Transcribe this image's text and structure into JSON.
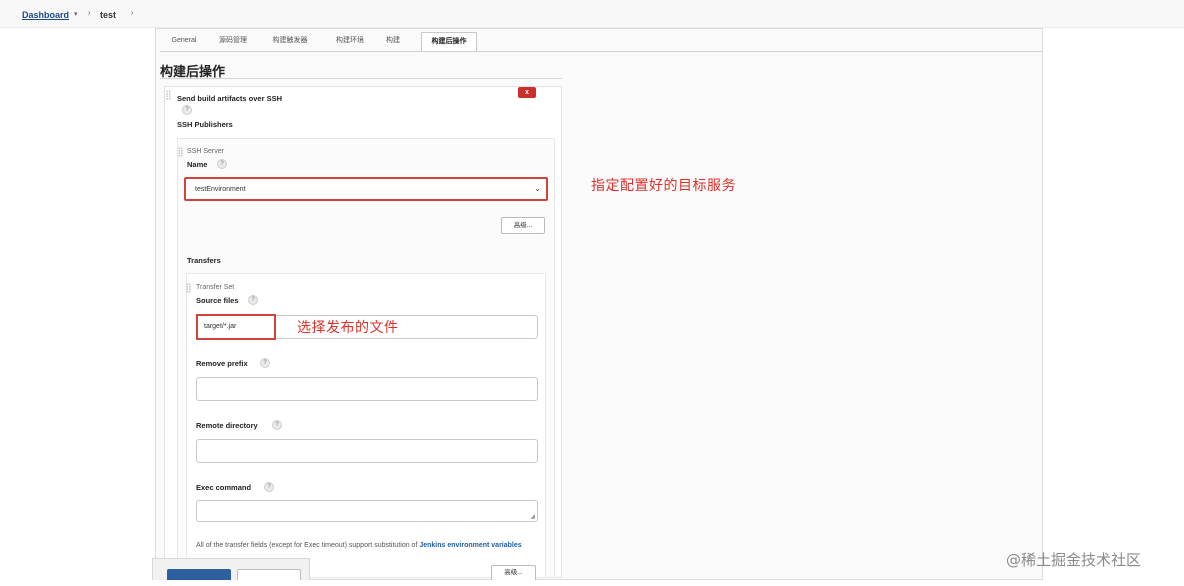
{
  "breadcrumb": {
    "root": "Dashboard",
    "project": "test"
  },
  "tabs": [
    "General",
    "源码管理",
    "构建触发器",
    "构建环境",
    "构建",
    "构建后操作"
  ],
  "section_title": "构建后操作",
  "step": {
    "title": "Send build artifacts over SSH",
    "help": "?",
    "delete_label": "x",
    "publishers_label": "SSH Publishers",
    "server": {
      "group_label": "SSH Server",
      "name_label": "Name",
      "name_value": "testEnvironment",
      "advanced_button": "高级..."
    },
    "transfers_label": "Transfers",
    "transfer_set": {
      "group_label": "Transfer Set",
      "source_files_label": "Source files",
      "source_files_value": "target/*.jar",
      "remove_prefix_label": "Remove prefix",
      "remote_directory_label": "Remote directory",
      "exec_command_label": "Exec command",
      "note_text": "All of the transfer fields (except for Exec timeout) support substitution of ",
      "note_link": "Jenkins environment variables",
      "advanced_button": "高级..."
    }
  },
  "annotations": {
    "server": "指定配置好的目标服务",
    "files": "选择发布的文件"
  },
  "watermark": "@稀土掘金技术社区",
  "colors": {
    "annotation_red": "#e0302a",
    "link_blue": "#204a87",
    "delete_red": "#c9302c"
  }
}
